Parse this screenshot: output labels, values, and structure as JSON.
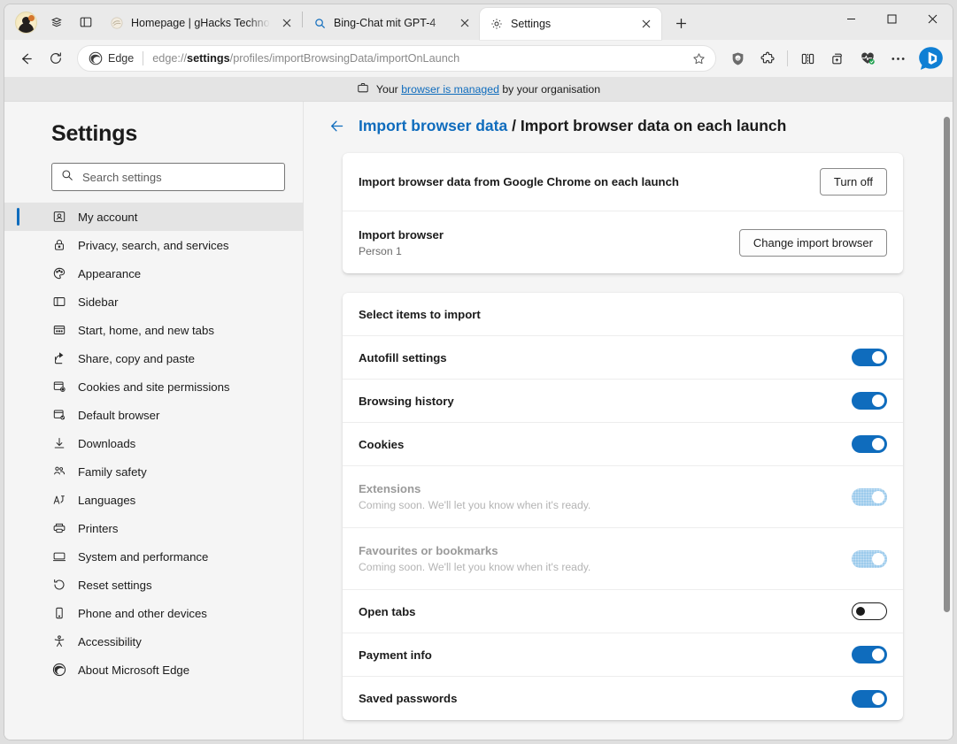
{
  "window": {
    "controls": {
      "minimize": "minimize-button",
      "maximize": "maximize-button",
      "close": "close-button"
    }
  },
  "tabstrip": {
    "tabs": [
      {
        "title": "Homepage | gHacks Technology",
        "favicon": "ghacks-favicon",
        "active": false
      },
      {
        "title": "Bing-Chat mit GPT-4",
        "favicon": "search-icon",
        "active": false
      },
      {
        "title": "Settings",
        "favicon": "gear-icon",
        "active": true
      }
    ],
    "new_tab_label": "+"
  },
  "navbar": {
    "back_label": "Back",
    "refresh_label": "Refresh",
    "edge_badge": "Edge",
    "url_prefix": "edge://",
    "url_strong": "settings",
    "url_suffix": "/profiles/importBrowsingData/importOnLaunch",
    "url_full": "edge://settings/profiles/importBrowsingData/importOnLaunch",
    "icons": [
      "ublock-shield-icon",
      "extensions-puzzle-icon",
      "split-screen-icon",
      "collections-icon",
      "browser-essentials-icon",
      "more-options-icon",
      "bing-chat-icon"
    ]
  },
  "managed_banner": {
    "prefix": "Your ",
    "link": "browser is managed",
    "suffix": " by your organisation"
  },
  "sidebar": {
    "title": "Settings",
    "search": {
      "placeholder": "Search settings",
      "value": ""
    },
    "items": [
      {
        "label": "My account",
        "icon": "account-icon",
        "selected": true
      },
      {
        "label": "Privacy, search, and services",
        "icon": "lock-icon",
        "selected": false
      },
      {
        "label": "Appearance",
        "icon": "palette-icon",
        "selected": false
      },
      {
        "label": "Sidebar",
        "icon": "sidebar-icon",
        "selected": false
      },
      {
        "label": "Start, home, and new tabs",
        "icon": "start-home-icon",
        "selected": false
      },
      {
        "label": "Share, copy and paste",
        "icon": "share-icon",
        "selected": false
      },
      {
        "label": "Cookies and site permissions",
        "icon": "cookies-icon",
        "selected": false
      },
      {
        "label": "Default browser",
        "icon": "default-browser-icon",
        "selected": false
      },
      {
        "label": "Downloads",
        "icon": "download-icon",
        "selected": false
      },
      {
        "label": "Family safety",
        "icon": "family-icon",
        "selected": false
      },
      {
        "label": "Languages",
        "icon": "languages-icon",
        "selected": false
      },
      {
        "label": "Printers",
        "icon": "printer-icon",
        "selected": false
      },
      {
        "label": "System and performance",
        "icon": "monitor-icon",
        "selected": false
      },
      {
        "label": "Reset settings",
        "icon": "reset-icon",
        "selected": false
      },
      {
        "label": "Phone and other devices",
        "icon": "phone-icon",
        "selected": false
      },
      {
        "label": "Accessibility",
        "icon": "accessibility-icon",
        "selected": false
      },
      {
        "label": "About Microsoft Edge",
        "icon": "edge-logo-icon",
        "selected": false
      }
    ]
  },
  "main": {
    "breadcrumb": {
      "parent": "Import browser data",
      "separator": " / ",
      "current": "Import browser data on each launch"
    },
    "card1": {
      "row1": {
        "label": "Import browser data from Google Chrome on each launch",
        "button": "Turn off"
      },
      "row2": {
        "label": "Import browser",
        "sub": "Person 1",
        "button": "Change import browser"
      }
    },
    "card2": {
      "heading": "Select items to import",
      "items": [
        {
          "label": "Autofill settings",
          "sub": "",
          "state": "on",
          "disabled": false
        },
        {
          "label": "Browsing history",
          "sub": "",
          "state": "on",
          "disabled": false
        },
        {
          "label": "Cookies",
          "sub": "",
          "state": "on",
          "disabled": false
        },
        {
          "label": "Extensions",
          "sub": "Coming soon. We'll let you know when it's ready.",
          "state": "on",
          "disabled": true
        },
        {
          "label": "Favourites or bookmarks",
          "sub": "Coming soon. We'll let you know when it's ready.",
          "state": "on",
          "disabled": true
        },
        {
          "label": "Open tabs",
          "sub": "",
          "state": "off",
          "disabled": false
        },
        {
          "label": "Payment info",
          "sub": "",
          "state": "on",
          "disabled": false
        },
        {
          "label": "Saved passwords",
          "sub": "",
          "state": "on",
          "disabled": false
        }
      ]
    }
  },
  "colors": {
    "accent": "#0f6cbd",
    "link": "#0f6cbd",
    "toggle_on": "#0f6cbd",
    "toggle_disabled": "#9ccbec"
  }
}
